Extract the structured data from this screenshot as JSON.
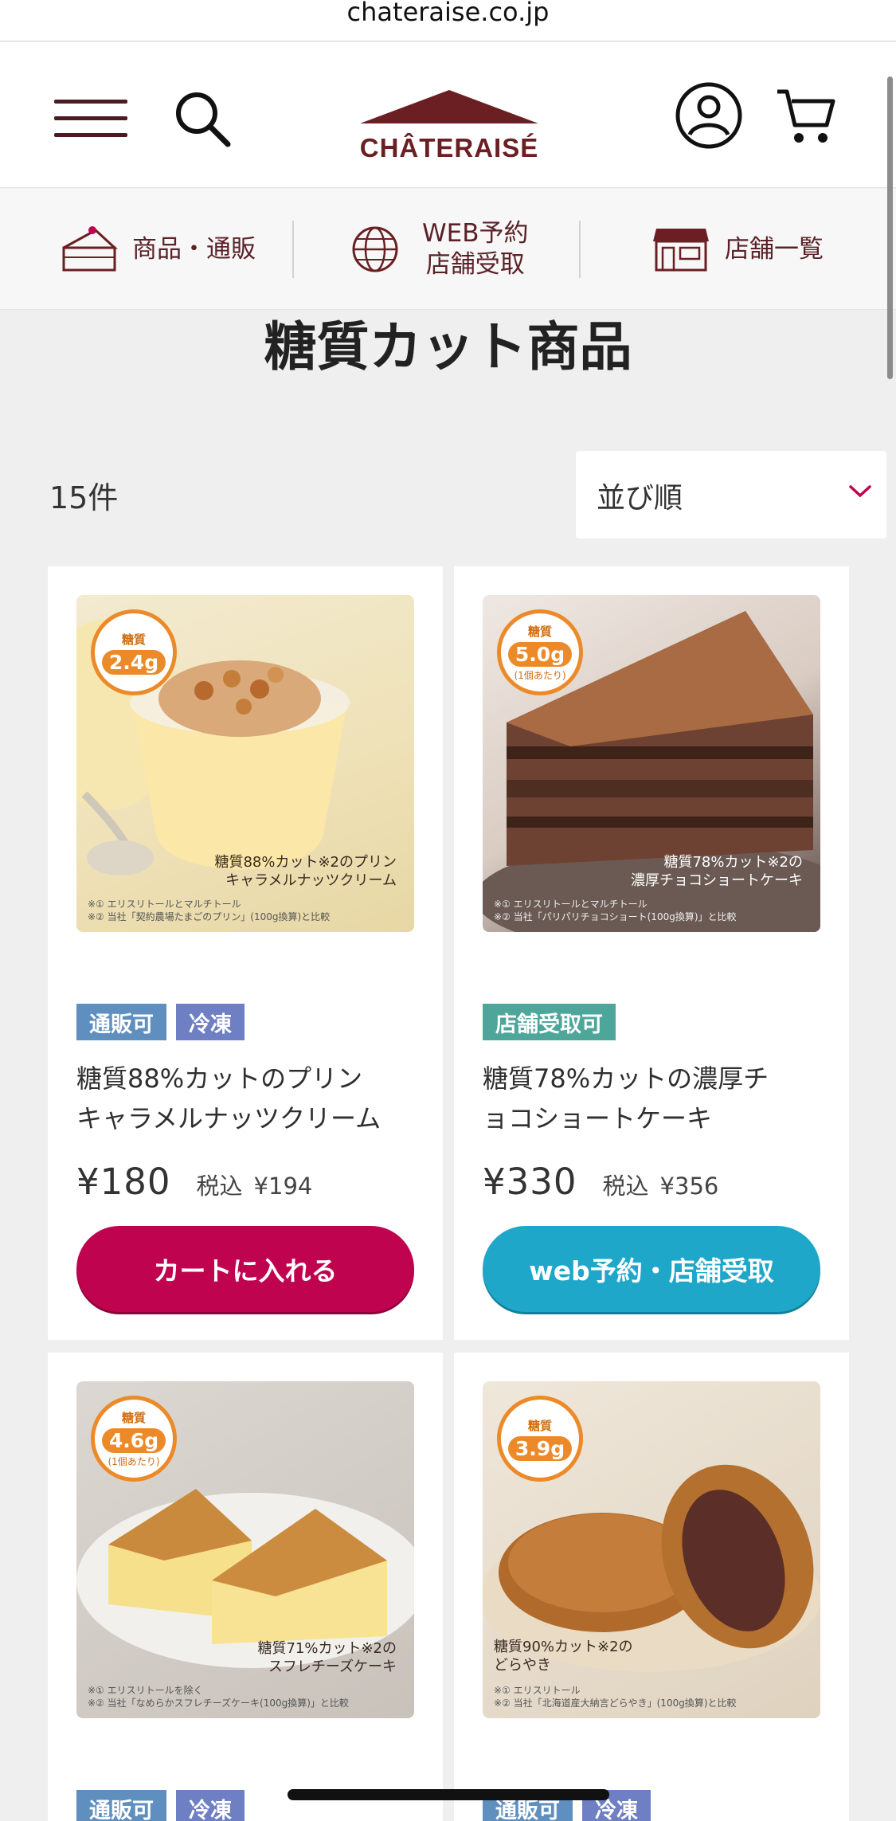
{
  "browser": {
    "url": "chateraise.co.jp"
  },
  "header": {
    "logo_text": "CHÂTERAISÉ",
    "menu_icon": "hamburger-menu-icon",
    "search_icon": "search-icon",
    "account_icon": "account-icon",
    "cart_icon": "cart-icon"
  },
  "nav": {
    "items": [
      {
        "label": "商品・通販",
        "icon": "cake-icon"
      },
      {
        "label": "WEB予約\n店舗受取",
        "line1": "WEB予約",
        "line2": "店舗受取",
        "icon": "globe-icon"
      },
      {
        "label": "店舗一覧",
        "icon": "store-icon"
      }
    ]
  },
  "page": {
    "title": "糖質カット商品",
    "count": "15件",
    "sort_label": "並び順"
  },
  "colors": {
    "brand": "#6b1f22",
    "cart_button": "#c0034f",
    "web_button": "#1fa7c9",
    "badge_orange": "#ec8a2a",
    "tag_blue": "#5f8fbf",
    "tag_purple": "#6f7fc4",
    "tag_green": "#4ea69b"
  },
  "products": [
    {
      "badge": {
        "top": "糖質",
        "value": "2.4g"
      },
      "img_caption_line1": "糖質88%カット※2のプリン",
      "img_caption_line2": "キャラメルナッツクリーム",
      "img_note1": "※① エリスリトールとマルチトール",
      "img_note2": "※② 当社「契約農場たまごのプリン」(100g換算)と比較",
      "tags": [
        "通販可",
        "冷凍"
      ],
      "name_line1": "糖質88%カットのプリン",
      "name_line2": "キャラメルナッツクリーム",
      "price": "¥180",
      "tax_label": "税込",
      "tax_price": "¥194",
      "button": "カートに入れる"
    },
    {
      "badge": {
        "top": "糖質",
        "value": "5.0g",
        "sub": "(1個あたり)"
      },
      "img_caption_line1": "糖質78%カット※2の",
      "img_caption_line2": "濃厚チョコショートケーキ",
      "img_note1": "※① エリスリトールとマルチトール",
      "img_note2": "※② 当社「パリパリチョコショート(100g換算)」と比較",
      "tags": [
        "店舗受取可"
      ],
      "name_line1": "糖質78%カットの濃厚チ",
      "name_line2": "ョコショートケーキ",
      "price": "¥330",
      "tax_label": "税込",
      "tax_price": "¥356",
      "button": "web予約・店舗受取"
    },
    {
      "badge": {
        "top": "糖質",
        "value": "4.6g",
        "sub": "(1個あたり)"
      },
      "img_caption_line1": "糖質71%カット※2の",
      "img_caption_line2": "スフレチーズケーキ",
      "img_note1": "※① エリスリトールを除く",
      "img_note2": "※② 当社「なめらかスフレチーズケーキ(100g換算)」と比較",
      "tags": [
        "通販可",
        "冷凍"
      ]
    },
    {
      "badge": {
        "top": "糖質",
        "value": "3.9g"
      },
      "img_caption_line1": "糖質90%カット※2の",
      "img_caption_line2": "どらやき",
      "img_note1": "※① エリスリトール",
      "img_note2": "※② 当社「北海道産大納言どらやき」(100g換算)と比較",
      "tags": [
        "通販可",
        "冷凍"
      ]
    }
  ]
}
